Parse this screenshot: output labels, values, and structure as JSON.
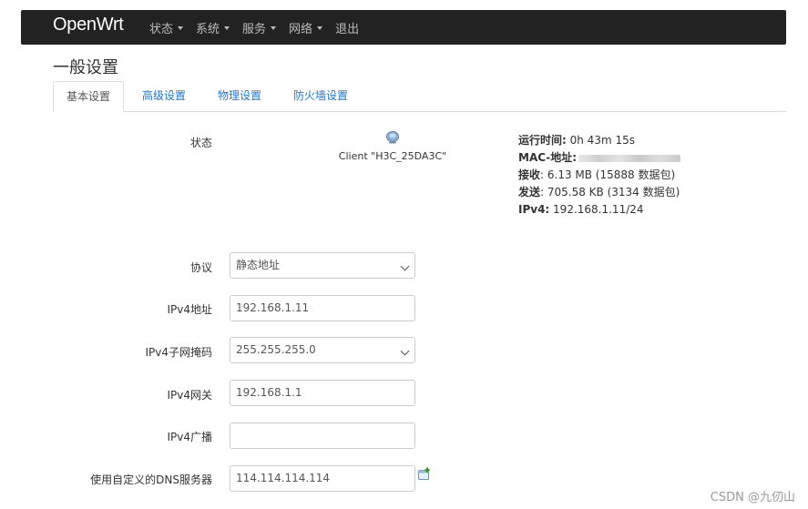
{
  "navbar": {
    "brand": "OpenWrt",
    "menu": [
      {
        "label": "状态",
        "dropdown": true
      },
      {
        "label": "系统",
        "dropdown": true
      },
      {
        "label": "服务",
        "dropdown": true
      },
      {
        "label": "网络",
        "dropdown": true
      },
      {
        "label": "退出",
        "dropdown": false
      }
    ]
  },
  "page": {
    "title": "一般设置",
    "tabs": [
      "基本设置",
      "高级设置",
      "物理设置",
      "防火墙设置"
    ],
    "active_tab": "基本设置"
  },
  "status": {
    "label": "状态",
    "client": "Client \"H3C_25DA3C\"",
    "uptime_label": "运行时间:",
    "uptime_value": " 0h 43m 15s",
    "mac_label": "MAC-地址:",
    "rx_label": "接收",
    "rx_value": ": 6.13 MB (15888 数据包)",
    "tx_label": "发送",
    "tx_value": ": 705.58 KB (3134 数据包)",
    "ipv4_label": "IPv4:",
    "ipv4_value": " 192.168.1.11/24"
  },
  "form": {
    "protocol": {
      "label": "协议",
      "value": "静态地址"
    },
    "ipv4_address": {
      "label": "IPv4地址",
      "value": "192.168.1.11"
    },
    "ipv4_netmask": {
      "label": "IPv4子网掩码",
      "value": "255.255.255.0"
    },
    "ipv4_gateway": {
      "label": "IPv4网关",
      "value": "192.168.1.1"
    },
    "ipv4_broadcast": {
      "label": "IPv4广播",
      "value": ""
    },
    "custom_dns": {
      "label": "使用自定义的DNS服务器",
      "value": "114.114.114.114"
    }
  },
  "watermark": "CSDN @九仞山",
  "colors": {
    "navbar_bg": "#222222",
    "link": "#1f77d0"
  }
}
